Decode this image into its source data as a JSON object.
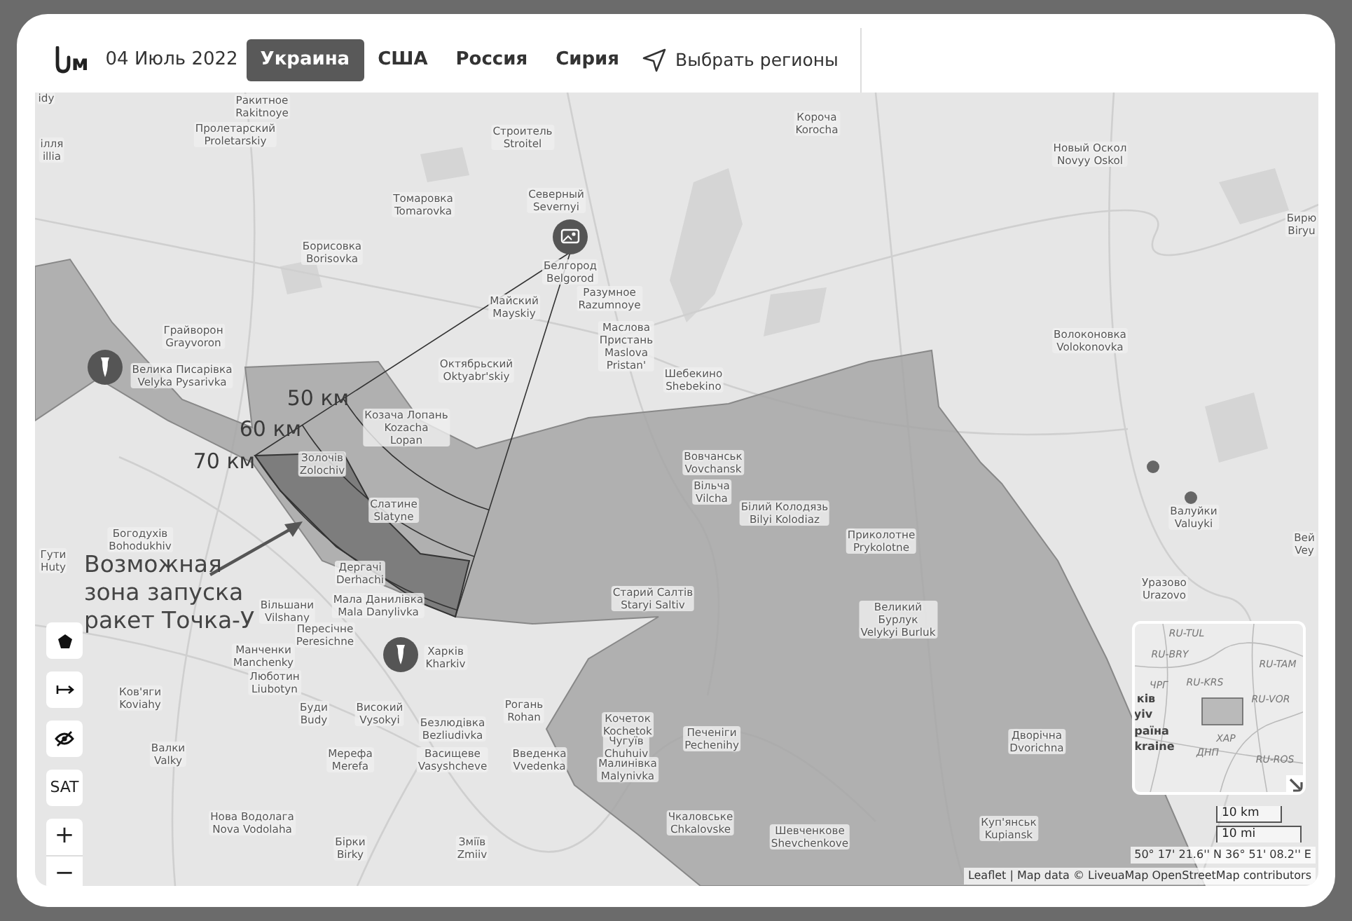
{
  "header": {
    "logo_text": "м",
    "date": "04 Июль 2022",
    "tabs": [
      {
        "label": "Украина",
        "selected": true
      },
      {
        "label": "США",
        "selected": false
      },
      {
        "label": "Россия",
        "selected": false
      },
      {
        "label": "Сирия",
        "selected": false
      }
    ],
    "region_picker": "Выбрать регионы"
  },
  "map": {
    "places": [
      {
        "lines": [
          "idy"
        ]
      },
      {
        "lines": [
          "Ракитное",
          "Rakitnoye"
        ]
      },
      {
        "lines": [
          "Пролетарский",
          "Proletarskiy"
        ]
      },
      {
        "lines": [
          "ілля",
          "illia"
        ]
      },
      {
        "lines": [
          "Строитель",
          "Stroitel"
        ]
      },
      {
        "lines": [
          "Короча",
          "Korocha"
        ]
      },
      {
        "lines": [
          "Новый Оскол",
          "Novyy Oskol"
        ]
      },
      {
        "lines": [
          "Томаровка",
          "Tomarovka"
        ]
      },
      {
        "lines": [
          "Северный",
          "Severnyi"
        ]
      },
      {
        "lines": [
          "Бирю",
          "Biryu"
        ]
      },
      {
        "lines": [
          "Борисовка",
          "Borisovka"
        ]
      },
      {
        "lines": [
          "Белгород",
          "Belgorod"
        ]
      },
      {
        "lines": [
          "Майский",
          "Mayskiy"
        ]
      },
      {
        "lines": [
          "Разумное",
          "Razumnoye"
        ]
      },
      {
        "lines": [
          "Грайворон",
          "Grayvoron"
        ]
      },
      {
        "lines": [
          "Маслова",
          "Пристань",
          "Maslova",
          "Pristan'"
        ]
      },
      {
        "lines": [
          "Волоконовка",
          "Volokonovka"
        ]
      },
      {
        "lines": [
          "Октябрьский",
          "Oktyabr'skiy"
        ]
      },
      {
        "lines": [
          "Велика Писарівка",
          "Velyka Pysarivka"
        ]
      },
      {
        "lines": [
          "Шебекино",
          "Shebekino"
        ]
      },
      {
        "lines": [
          "Козача Лопань",
          "Kozacha",
          "Lopan"
        ]
      },
      {
        "lines": [
          "Золочів",
          "Zolochiv"
        ]
      },
      {
        "lines": [
          "Вовчанськ",
          "Vovchansk"
        ]
      },
      {
        "lines": [
          "Вільча",
          "Vilcha"
        ]
      },
      {
        "lines": [
          "Слатине",
          "Slatyne"
        ]
      },
      {
        "lines": [
          "Білий Колодязь",
          "Bilyi Kolodiaz"
        ]
      },
      {
        "lines": [
          "Валуйки",
          "Valuyki"
        ]
      },
      {
        "lines": [
          "Богодухів",
          "Bohodukhiv"
        ]
      },
      {
        "lines": [
          "Приколотне",
          "Prykolotne"
        ]
      },
      {
        "lines": [
          "Вей",
          "Vey"
        ]
      },
      {
        "lines": [
          "Гути",
          "Huty"
        ]
      },
      {
        "lines": [
          "Дергачі",
          "Derhachi"
        ]
      },
      {
        "lines": [
          "Уразово",
          "Urazovo"
        ]
      },
      {
        "lines": [
          "Старий Салтів",
          "Staryi Saltiv"
        ]
      },
      {
        "lines": [
          "Мала Данилівка",
          "Mala Danylivka"
        ]
      },
      {
        "lines": [
          "Вільшани",
          "Vilshany"
        ]
      },
      {
        "lines": [
          "Великий",
          "Бурлук",
          "Velykyi Burluk"
        ]
      },
      {
        "lines": [
          "Пересічне",
          "Peresichne"
        ]
      },
      {
        "lines": [
          "Манченки",
          "Manchenky"
        ]
      },
      {
        "lines": [
          "Харків",
          "Kharkiv"
        ]
      },
      {
        "lines": [
          "Люботин",
          "Liubotyn"
        ]
      },
      {
        "lines": [
          "Ков'яги",
          "Koviahy"
        ]
      },
      {
        "lines": [
          "Буди",
          "Budy"
        ]
      },
      {
        "lines": [
          "Високий",
          "Vysokyi"
        ]
      },
      {
        "lines": [
          "Рогань",
          "Rohan"
        ]
      },
      {
        "lines": [
          "Безлюдівка",
          "Bezliudivka"
        ]
      },
      {
        "lines": [
          "Кочеток",
          "Kochetok"
        ]
      },
      {
        "lines": [
          "Печеніги",
          "Pechenihy"
        ]
      },
      {
        "lines": [
          "Дворічна",
          "Dvorichna"
        ]
      },
      {
        "lines": [
          "Валки",
          "Valky"
        ]
      },
      {
        "lines": [
          "Мерефа",
          "Merefa"
        ]
      },
      {
        "lines": [
          "Васищеве",
          "Vasyshcheve"
        ]
      },
      {
        "lines": [
          "Введенка",
          "Vvedenka"
        ]
      },
      {
        "lines": [
          "Чугуїв",
          "Chuhuiv"
        ]
      },
      {
        "lines": [
          "Малинівка",
          "Malynivka"
        ]
      },
      {
        "lines": [
          "Нова Водолага",
          "Nova Vodolaha"
        ]
      },
      {
        "lines": [
          "Чкаловське",
          "Chkalovske"
        ]
      },
      {
        "lines": [
          "Куп'янськ",
          "Kupiansk"
        ]
      },
      {
        "lines": [
          "Шевченкове",
          "Shevchenkove"
        ]
      },
      {
        "lines": [
          "Бірки",
          "Birky"
        ]
      },
      {
        "lines": [
          "Зміїв",
          "Zmiiv"
        ]
      }
    ],
    "range_labels": [
      "50 км",
      "60 км",
      "70 км"
    ],
    "annotation": "Возможная зона запуска ракет Точка-У",
    "markers": [
      {
        "kind": "photo"
      },
      {
        "kind": "missile"
      },
      {
        "kind": "missile"
      },
      {
        "kind": "dot"
      },
      {
        "kind": "dot"
      }
    ],
    "controls": [
      {
        "kind": "polygon"
      },
      {
        "kind": "measure"
      },
      {
        "kind": "hide"
      },
      {
        "kind": "text",
        "label": "SAT"
      },
      {
        "kind": "text",
        "label": "+"
      },
      {
        "kind": "text",
        "label": "−"
      }
    ],
    "minimap": {
      "labels": [
        "RU-TUL",
        "RU-BRY",
        "RU-TAM",
        "ЧРГ",
        "RU-KRS",
        "RU-VOR",
        "ків",
        "yiv",
        "раїна",
        "kraine",
        "ХАР",
        "ДНП",
        "RU-ROS"
      ]
    },
    "scale": [
      "10 km",
      "10 mi"
    ],
    "coordinates": "50° 17' 21.6'' N 36° 51' 08.2'' E",
    "attribution": {
      "leaflet": "Leaflet",
      "separator": "| Map data ©",
      "source": "LiveuaMap",
      "contributors": "OpenStreetMap contributors"
    }
  }
}
